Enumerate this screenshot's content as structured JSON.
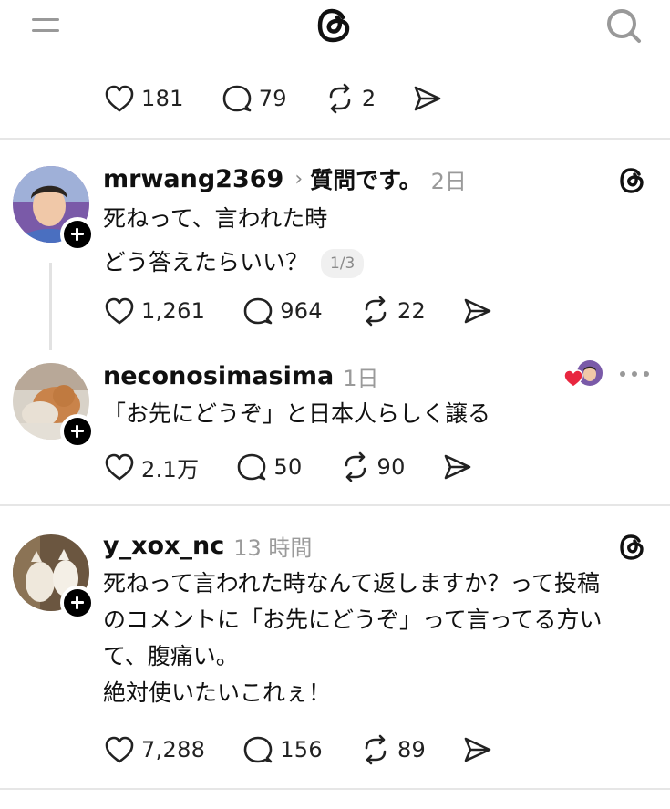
{
  "app": {
    "name": "Threads"
  },
  "top_post_actions": {
    "likes": "181",
    "replies": "79",
    "reposts": "2"
  },
  "posts": [
    {
      "username": "mrwang2369",
      "topic": "質問です。",
      "time": "2日",
      "lines": [
        "死ねって、言われた時",
        "どう答えたらいい？"
      ],
      "page_badge": "1/3",
      "likes": "1,261",
      "replies": "964",
      "reposts": "22"
    },
    {
      "username": "neconosimasima",
      "time": "1日",
      "lines": [
        "「お先にどうぞ」と日本人らしく譲る"
      ],
      "likes": "2.1万",
      "replies": "50",
      "reposts": "90"
    },
    {
      "username": "y_xox_nc",
      "time": "13 時間",
      "lines": [
        "死ねって言われた時なんて返しますか？って投稿",
        "のコメントに「お先にどうぞ」って言ってる方い",
        "て、腹痛い。",
        "絶対使いたいこれぇ！"
      ],
      "likes": "7,288",
      "replies": "156",
      "reposts": "89"
    }
  ],
  "colors": {
    "heart_red": "#e8263f",
    "muted": "#9a9a9a",
    "divider": "#e6e6e6"
  }
}
